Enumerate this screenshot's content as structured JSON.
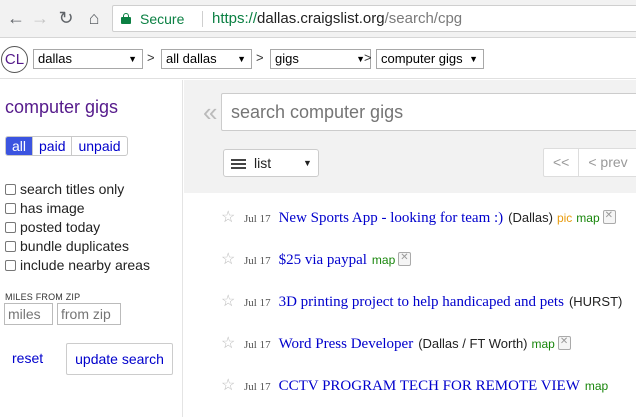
{
  "browser": {
    "secure_label": "Secure",
    "url_scheme": "https://",
    "url_host": "dallas.craigslist.org",
    "url_path": "/search/cpg",
    "icons": {
      "back": "arrow-left-icon",
      "forward": "arrow-right-icon",
      "reload": "reload-icon",
      "home": "home-icon",
      "lock": "lock-icon"
    }
  },
  "header": {
    "logo": "CL",
    "breadcrumbs": [
      "dallas",
      "all dallas",
      "gigs",
      "computer gigs"
    ],
    "separator": ">"
  },
  "sidebar": {
    "title": "computer gigs",
    "pay_filter": [
      "all",
      "paid",
      "unpaid"
    ],
    "pay_selected": "all",
    "checkboxes": [
      "search titles only",
      "has image",
      "posted today",
      "bundle duplicates",
      "include nearby areas"
    ],
    "miles_label": "MILES FROM ZIP",
    "miles_placeholder": "miles",
    "zip_placeholder": "from zip",
    "reset_label": "reset",
    "update_label": "update search"
  },
  "main": {
    "search_placeholder": "search computer gigs",
    "view_mode": "list",
    "pager": [
      "<<",
      "< prev"
    ],
    "results": [
      {
        "date": "Jul 17",
        "title": "New Sports App - looking for team :)",
        "hood": "(Dallas)",
        "pic": "pic",
        "map": "map"
      },
      {
        "date": "Jul 17",
        "title": "$25 via paypal",
        "hood": "",
        "pic": "",
        "map": "map"
      },
      {
        "date": "Jul 17",
        "title": "3D printing project to help handicaped and pets",
        "hood": "(HURST)",
        "pic": "",
        "map": ""
      },
      {
        "date": "Jul 17",
        "title": "Word Press Developer",
        "hood": "(Dallas / FT Worth)",
        "pic": "",
        "map": "map"
      },
      {
        "date": "Jul 17",
        "title": "CCTV PROGRAM TECH FOR REMOTE VIEW",
        "hood": "",
        "pic": "",
        "map": "map"
      }
    ]
  },
  "colors": {
    "link": "#0000cc",
    "visited_purple": "#551a8b",
    "secure_green": "#0b8043",
    "map_green": "#18860b",
    "pic_orange": "#e89b0d",
    "active_segment": "#3b54e0"
  }
}
